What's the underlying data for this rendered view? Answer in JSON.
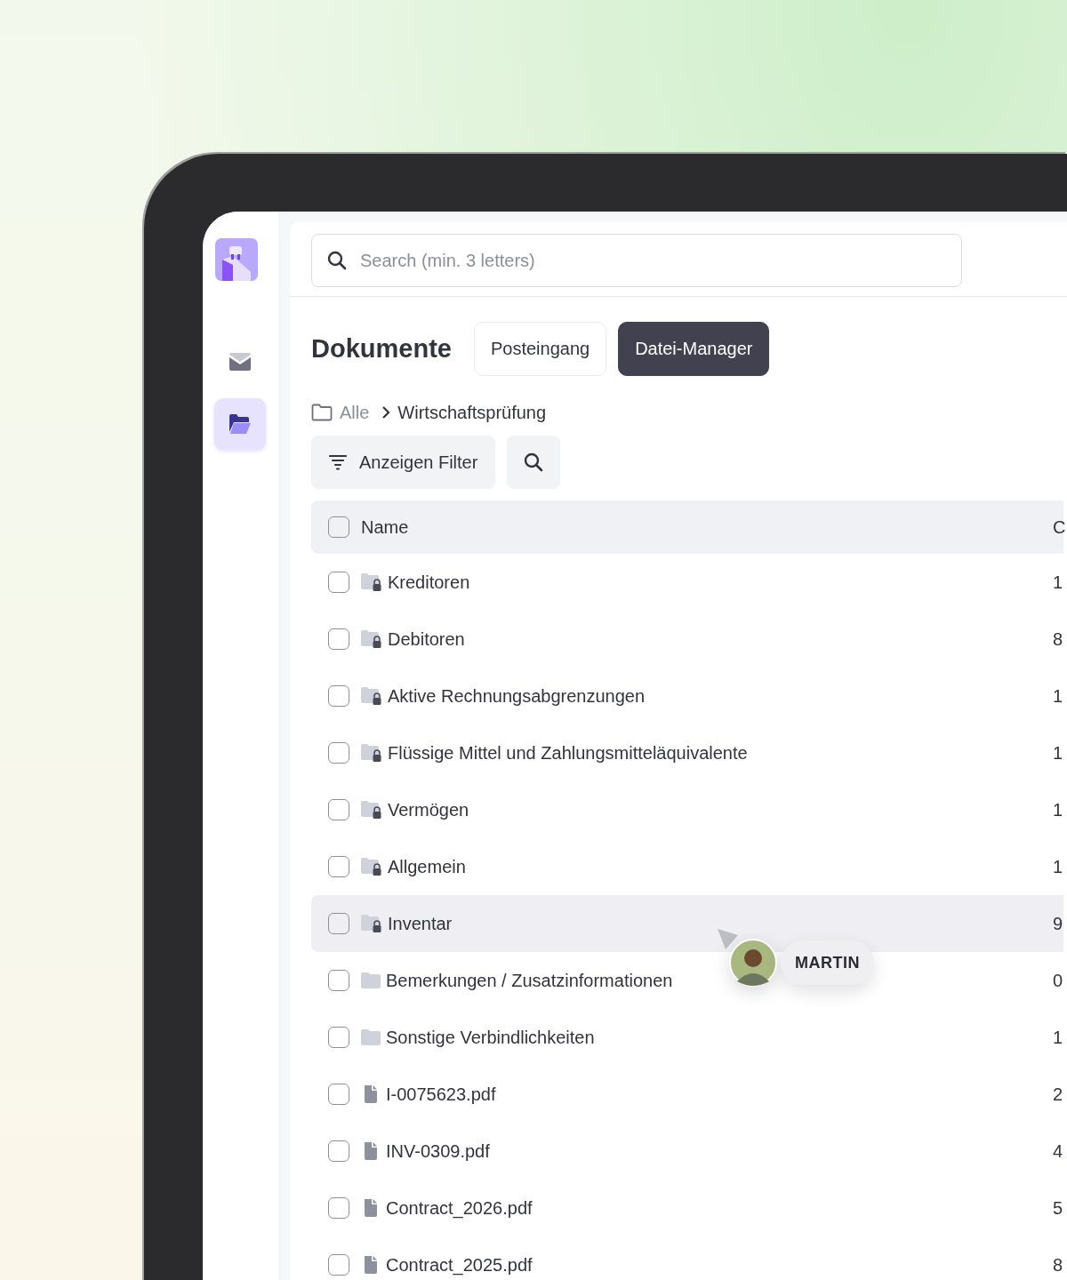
{
  "sidebar": {
    "items": [
      {
        "kind": "mail",
        "selected": false
      },
      {
        "kind": "folder",
        "selected": true
      }
    ]
  },
  "search": {
    "placeholder": "Search (min. 3 letters)"
  },
  "title": "Dokumente",
  "tabs": [
    {
      "label": "Posteingang",
      "selected": false
    },
    {
      "label": "Datei-Manager",
      "selected": true
    }
  ],
  "breadcrumb": [
    "Alle",
    "Wirtschaftsprüfung"
  ],
  "filter_button": "Anzeigen Filter",
  "table": {
    "columns": [
      "Name",
      "C"
    ],
    "header_checked": false,
    "rows": [
      {
        "kind": "locked_folder",
        "name": "Kreditoren",
        "column_2": "1",
        "checked": false,
        "hovered": false
      },
      {
        "kind": "locked_folder",
        "name": "Debitoren",
        "column_2": "8",
        "checked": false,
        "hovered": false
      },
      {
        "kind": "locked_folder",
        "name": "Aktive Rechnungsabgrenzungen",
        "column_2": "1",
        "checked": false,
        "hovered": false
      },
      {
        "kind": "locked_folder",
        "name": "Flüssige Mittel und Zahlungsmitteläquivalente",
        "column_2": "1",
        "checked": false,
        "hovered": false
      },
      {
        "kind": "locked_folder",
        "name": "Vermögen",
        "column_2": "1",
        "checked": false,
        "hovered": false
      },
      {
        "kind": "locked_folder",
        "name": "Allgemein",
        "column_2": "1",
        "checked": false,
        "hovered": false
      },
      {
        "kind": "locked_folder",
        "name": "Inventar",
        "column_2": "9",
        "checked": false,
        "hovered": true
      },
      {
        "kind": "folder",
        "name": "Bemerkungen / Zusatzinformationen",
        "column_2": "0",
        "checked": false,
        "hovered": false
      },
      {
        "kind": "folder",
        "name": "Sonstige Verbindlichkeiten",
        "column_2": "1",
        "checked": false,
        "hovered": false
      },
      {
        "kind": "file",
        "name": "I-0075623.pdf",
        "column_2": "2",
        "checked": false,
        "hovered": false
      },
      {
        "kind": "file",
        "name": "INV-0309.pdf",
        "column_2": "4",
        "checked": false,
        "hovered": false
      },
      {
        "kind": "file",
        "name": "Contract_2026.pdf",
        "column_2": "5",
        "checked": false,
        "hovered": false
      },
      {
        "kind": "file",
        "name": "Contract_2025.pdf",
        "column_2": "8",
        "checked": false,
        "hovered": false
      }
    ]
  },
  "cursor": {
    "label": "MARTIN"
  }
}
